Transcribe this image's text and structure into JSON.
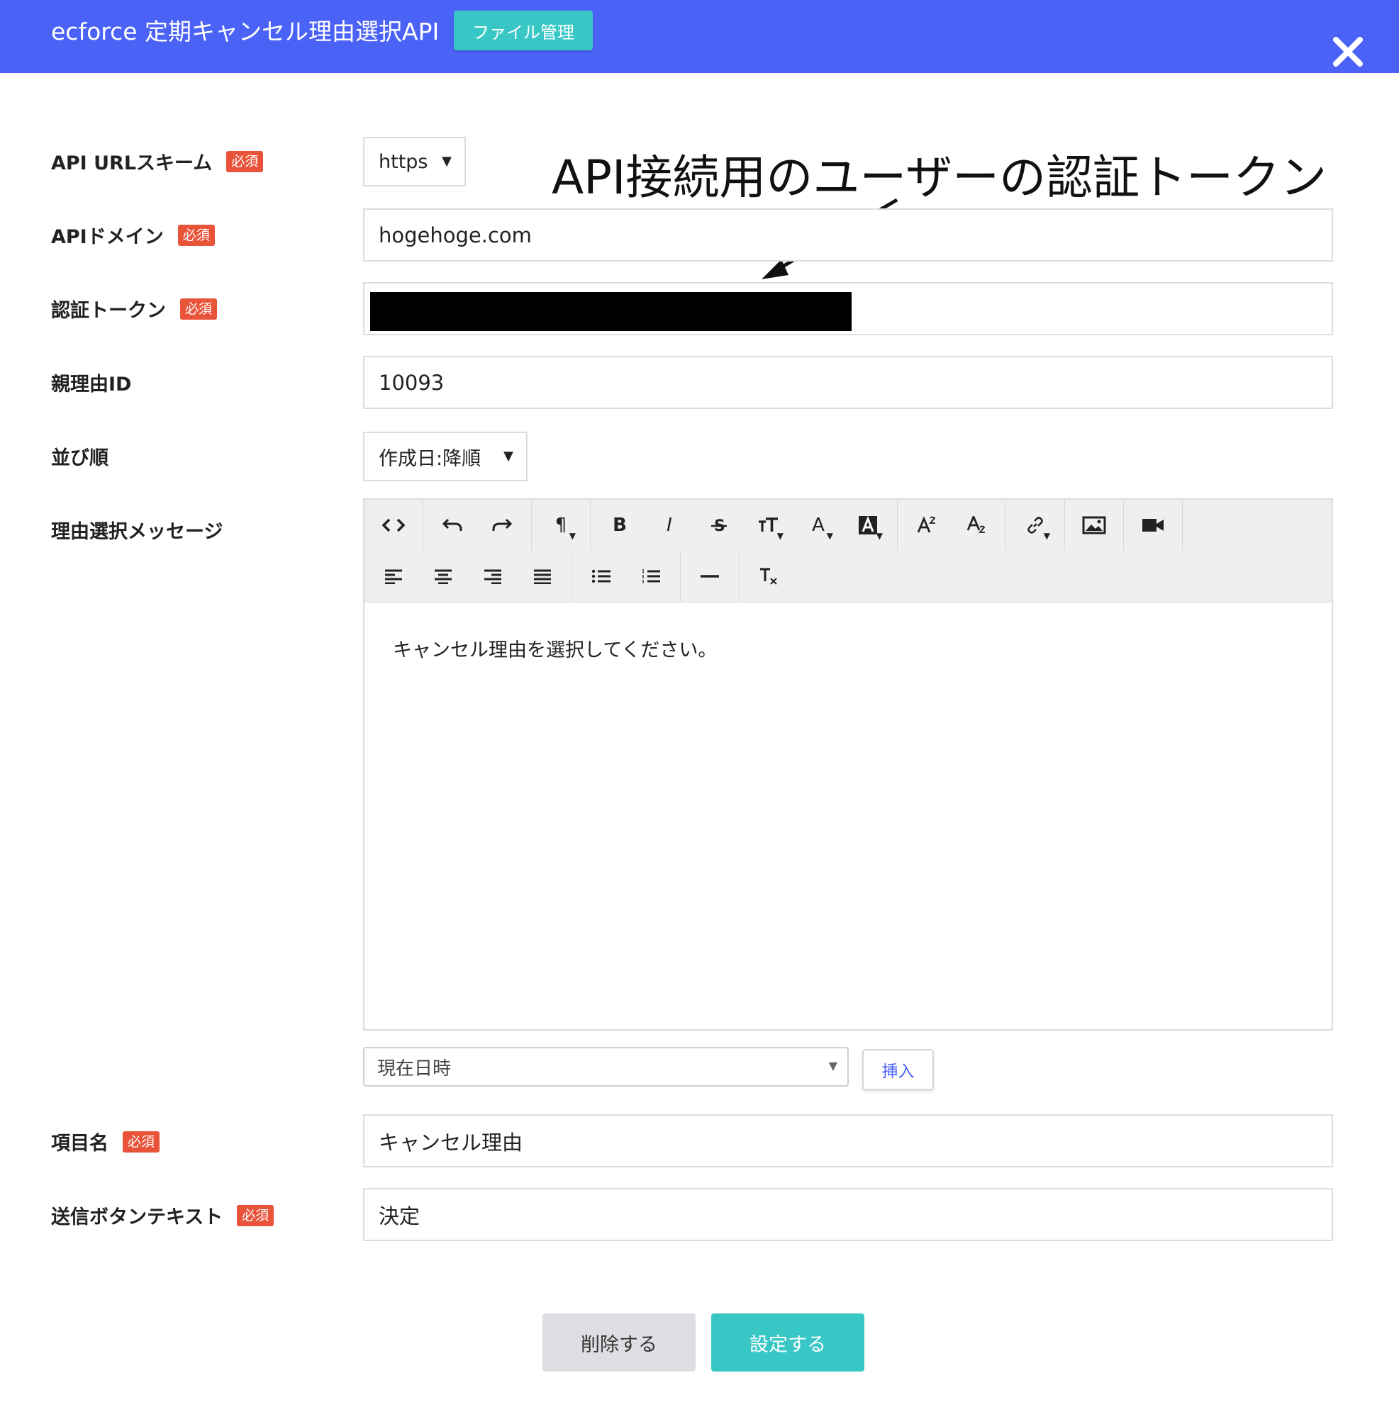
{
  "header": {
    "title": "ecforce 定期キャンセル理由選択API",
    "file_button": "ファイル管理",
    "close_icon": "close-icon"
  },
  "annotation": {
    "text": "API接続用のユーザーの認証トークン"
  },
  "required_badge": "必須",
  "fields": {
    "scheme": {
      "label": "API URLスキーム",
      "value": "https"
    },
    "domain": {
      "label": "APIドメイン",
      "value": "hogehoge.com"
    },
    "token": {
      "label": "認証トークン",
      "value": ""
    },
    "parent_id": {
      "label": "親理由ID",
      "value": "10093"
    },
    "sort": {
      "label": "並び順",
      "value": "作成日:降順"
    },
    "message": {
      "label": "理由選択メッセージ",
      "content": "キャンセル理由を選択してください。"
    },
    "item_name": {
      "label": "項目名",
      "value": "キャンセル理由"
    },
    "submit_text": {
      "label": "送信ボタンテキスト",
      "value": "決定"
    }
  },
  "variable_select": {
    "value": "現在日時",
    "insert_label": "挿入"
  },
  "toolbar": {
    "row1": [
      "code-view-icon",
      "undo-icon",
      "redo-icon",
      "paragraph-icon",
      "bold-icon",
      "italic-icon",
      "strikethrough-icon",
      "font-size-icon",
      "font-color-icon",
      "background-color-icon",
      "superscript-icon",
      "subscript-icon",
      "link-icon",
      "image-icon",
      "video-icon"
    ],
    "row2": [
      "align-left-icon",
      "align-center-icon",
      "align-right-icon",
      "align-justify-icon",
      "unordered-list-icon",
      "ordered-list-icon",
      "horizontal-rule-icon",
      "clear-format-icon"
    ],
    "glyphs": {
      "bold": "B",
      "italic": "I",
      "font_color": "A"
    }
  },
  "actions": {
    "delete": "削除する",
    "save": "設定する"
  },
  "colors": {
    "header": "#4b62f7",
    "accent": "#39c7c6",
    "required": "#e9533a"
  }
}
